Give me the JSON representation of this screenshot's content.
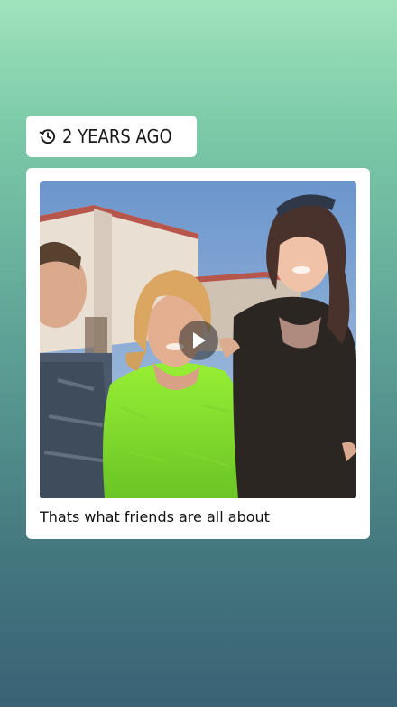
{
  "memory": {
    "timestamp_label": "2 YEARS AGO",
    "timestamp_icon": "history-clock-icon",
    "caption": "Thats what friends are all about",
    "media_type": "video",
    "play_icon": "play-icon"
  },
  "colors": {
    "background_top": "#9fe3bd",
    "background_bottom": "#3a6275",
    "card": "#ffffff"
  }
}
